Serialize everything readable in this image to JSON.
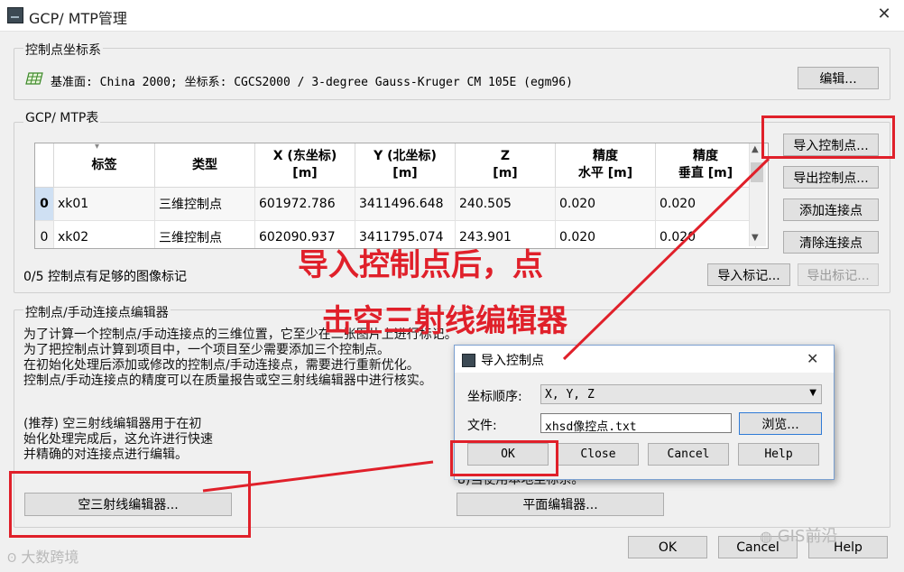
{
  "window": {
    "title": "GCP/ MTP管理",
    "close": "✕"
  },
  "coord_section": {
    "label": "控制点坐标系",
    "datum_text": "基准面: China 2000; 坐标系: CGCS2000 / 3-degree Gauss-Kruger CM 105E (egm96)",
    "edit_button": "编辑..."
  },
  "gcp_section": {
    "label": "GCP/ MTP表",
    "sort_indicator": "▾",
    "headers": {
      "label": "标签",
      "type": "类型",
      "x": "X (东坐标)",
      "x_unit": "[m]",
      "y": "Y (北坐标)",
      "y_unit": "[m]",
      "z": "Z",
      "z_unit": "[m]",
      "acc_h": "精度",
      "acc_h2": "水平 [m]",
      "acc_v": "精度",
      "acc_v2": "垂直 [m]"
    },
    "rows": [
      {
        "index": "0",
        "label": "xk01",
        "type": "三维控制点",
        "x": "601972.786",
        "y": "3411496.648",
        "z": "240.505",
        "h": "0.020",
        "v": "0.020"
      },
      {
        "index": "0",
        "label": "xk02",
        "type": "三维控制点",
        "x": "602090.937",
        "y": "3411795.074",
        "z": "243.901",
        "h": "0.020",
        "v": "0.020"
      }
    ],
    "status": "0/5 控制点有足够的图像标记",
    "buttons": {
      "import_gcp": "导入控制点...",
      "export_gcp": "导出控制点...",
      "add_tie": "添加连接点",
      "clear_tie": "清除连接点",
      "import_marks": "导入标记...",
      "export_marks": "导出标记..."
    }
  },
  "editor_section": {
    "label": "控制点/手动连接点编辑器",
    "desc_lines": [
      "为了计算一个控制点/手动连接点的三维位置，它至少在二张图片上进行标记。",
      "为了把控制点计算到项目中，一个项目至少需要添加三个控制点。",
      "在初始化处理后添加或修改的控制点/手动连接点，需要进行重新优化。",
      "控制点/手动连接点的精度可以在质量报告或空三射线编辑器中进行核实。"
    ],
    "recommend_lines": [
      "(推荐) 空三射线编辑器用于在初",
      "始化处理完成后，这允许进行快速",
      "并精确的对连接点进行编辑。"
    ],
    "right_partial": "8)当使用本地坐标系。",
    "ray_editor_button": "空三射线编辑器...",
    "plane_editor_button": "平面编辑器..."
  },
  "footer": {
    "ok": "OK",
    "cancel": "Cancel",
    "help": "Help"
  },
  "dialog": {
    "title": "导入控制点",
    "close": "✕",
    "order_label": "坐标顺序:",
    "order_value": "X, Y, Z",
    "file_label": "文件:",
    "file_value": "xhsd像控点.txt",
    "browse": "浏览...",
    "ok": "OK",
    "close_btn": "Close",
    "cancel": "Cancel",
    "help": "Help"
  },
  "annotation": {
    "line1": "导入控制点后，点",
    "line2": "击空三射线编辑器"
  },
  "watermarks": {
    "left": "大数跨境",
    "right": "GIS前沿"
  },
  "colors": {
    "annotation_red": "#e0202a",
    "selected_row_header": "#cfe0f3"
  }
}
